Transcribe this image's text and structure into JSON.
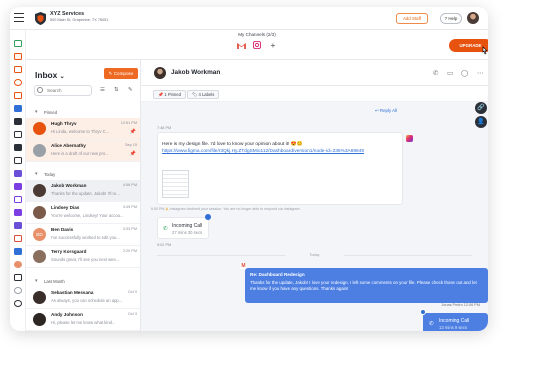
{
  "topbar": {
    "company_name": "XYZ Services",
    "company_address": "500 Main St, Grapevine, TX 76051",
    "add_staff": "Add Staff",
    "help": "Help"
  },
  "channels": {
    "title": "My Channels (2/3)",
    "add": "+"
  },
  "upgrade": "UPGRADE",
  "inbox": {
    "title": "Inbox",
    "caret": "⌄",
    "compose": "Compose",
    "search_placeholder": "Search",
    "sections": {
      "pinned": "Pinned",
      "today": "Today",
      "last_month": "Last Month"
    },
    "pinned": [
      {
        "name": "Hugh Thryv",
        "preview": "Hi Linda, welcome to Thryv C...",
        "time": "12:51 PM",
        "color": "#e8520f"
      },
      {
        "name": "Alice Abernathy",
        "preview": "Here is a draft of our new pro...",
        "time": "Sep 15",
        "color": "#9aa0a8"
      }
    ],
    "today": [
      {
        "name": "Jakob Workman",
        "preview": "Thanks for the update, Jakob! I'll re...",
        "time": "4:56 PM",
        "color": "#4b3a33"
      },
      {
        "name": "Lindsey Dias",
        "preview": "You're welcome, Lindsey! Your accou...",
        "time": "3:45 PM",
        "color": "#7a5a48"
      },
      {
        "name": "Ben Davis",
        "preview": "I've successfully worked to edit you...",
        "time": "3:33 PM",
        "initials": "BD",
        "color": "#e8906a"
      },
      {
        "name": "Terry Korsgaard",
        "preview": "Sounds great, I'll see you next wee...",
        "time": "2:20 PM",
        "color": "#8b6f5e"
      }
    ],
    "last_month": [
      {
        "name": "Sebastian Messana",
        "preview": "As always, you can schedule an app...",
        "time": "Oct 9",
        "color": "#3a2e2a"
      },
      {
        "name": "Andy Johnson",
        "preview": "Hi, please let me know what kind...",
        "time": "Oct 3",
        "color": "#2e2623"
      }
    ]
  },
  "chat": {
    "contact": "Jakob Workman",
    "tags": {
      "pinned": "1 Pinned",
      "labels": "4 Labels"
    },
    "reply_all": "Reply All",
    "incoming": {
      "time": "7:48 PM",
      "text": "Here is my design file. I'd love to know your opinion about it! 😍😊",
      "link": "https://www.figma.com/file/r3Qkj.Hy.ZTdgSMio112/Dashboard/version1/node-id=235%3A69849"
    },
    "error": {
      "time": "6:50 PM",
      "text": "Instagram declined your session. You are no longer able to respond via Instagram."
    },
    "incoming_call": {
      "title": "Incoming Call",
      "duration": "27 mins 30 secs",
      "time": "9:02 PM"
    },
    "day_divider": "Today",
    "outgoing": {
      "subject": "Re: Dashboard Redesign",
      "body": "Thanks for the update, Jakob! I love your redesign. I left some comments on your file. Please check those out and let me know if you have any questions. Thanks again!",
      "sent_by": "Jonas Pedro 12:06 PM"
    },
    "outgoing_call": {
      "title": "Incoming Call",
      "duration": "13 mins 9 secs"
    }
  }
}
